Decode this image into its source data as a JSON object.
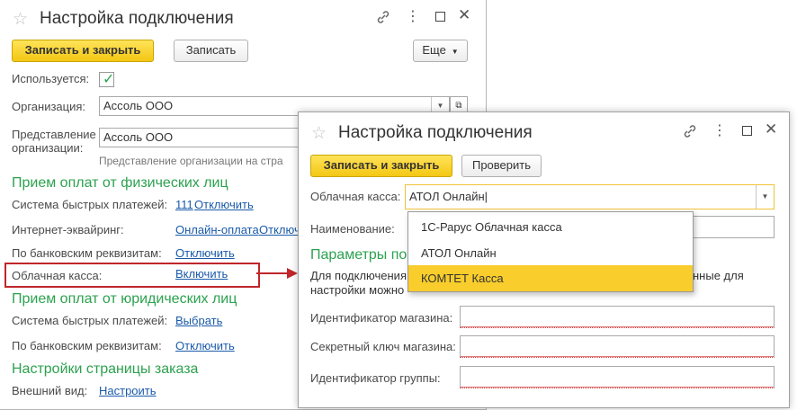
{
  "back_window": {
    "title": "Настройка подключения",
    "buttons": {
      "save_close": "Записать и закрыть",
      "save": "Записать",
      "more": "Еще"
    },
    "fields": {
      "used_label": "Используется:",
      "org_label": "Организация:",
      "org_value": "Ассоль ООО",
      "repr_label_1": "Представление",
      "repr_label_2": "организации:",
      "repr_value": "Ассоль ООО",
      "repr_hint": "Представление организации на стра"
    },
    "sections": {
      "individuals": "Прием оплат от физических лиц",
      "legal": "Прием оплат от юридических лиц",
      "order_page": "Настройки страницы заказа"
    },
    "individuals_rows": {
      "fast_pay_label": "Система быстрых платежей:",
      "fast_pay_count": "111",
      "fast_pay_link": "Отключить",
      "acquiring_label": "Интернет-эквайринг:",
      "acquiring_link_1": "Онлайн-оплата",
      "acquiring_link_2": "Отключ",
      "bank_label": "По банковским реквизитам:",
      "bank_link": "Отключить",
      "cloud_label": "Облачная касса:",
      "cloud_link": "Включить"
    },
    "legal_rows": {
      "fast_pay_label": "Система быстрых платежей:",
      "fast_pay_link": "Выбрать",
      "bank_label": "По банковским реквизитам:",
      "bank_link": "Отключить"
    },
    "order_rows": {
      "appearance_label": "Внешний вид:",
      "appearance_link": "Настроить"
    }
  },
  "front_window": {
    "title": "Настройка подключения",
    "buttons": {
      "save_close": "Записать и закрыть",
      "check": "Проверить"
    },
    "cloud_label": "Облачная касса:",
    "cloud_value": "АТОЛ Онлайн",
    "name_label": "Наименование:",
    "params_title": "Параметры по",
    "info_line_1_a": "Для подключения",
    "info_line_1_b": "нные для",
    "info_line_2": "настройки можно",
    "shop_id_label": "Идентификатор магазина:",
    "secret_label": "Секретный ключ магазина:",
    "group_label": "Идентификатор группы:",
    "dropdown_options": [
      "1С-Рарус Облачная касса",
      "АТОЛ Онлайн",
      "КОМТЕТ Касса"
    ],
    "dropdown_highlighted": "КОМТЕТ Касса"
  },
  "colors": {
    "highlight_box": "#c0262b",
    "section_green": "#2ca24f",
    "primary_button": "#f5cc1a",
    "link": "#1a5aa9"
  },
  "icons": [
    "star-icon",
    "link-icon",
    "more-icon",
    "maximize-icon",
    "close-icon",
    "checkbox-checked-icon",
    "dropdown-arrow-icon",
    "open-icon",
    "arrow-right-icon"
  ]
}
